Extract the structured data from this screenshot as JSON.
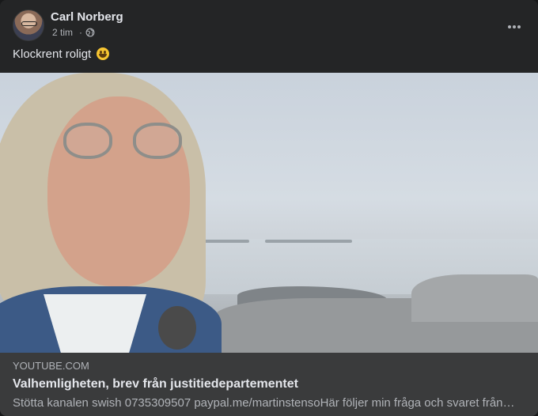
{
  "post": {
    "author": "Carl Norberg",
    "time": "2 tim",
    "separator": "·",
    "privacy_icon": "globe-icon",
    "more_icon": "more-options-icon",
    "text": "Klockrent roligt",
    "emoji": "grinning-face-emoji"
  },
  "link": {
    "domain": "YOUTUBE.COM",
    "title": "Valhemligheten, brev från justitiedepartementet",
    "description": "Stötta kanalen swish 0735309507 paypal.me/martinstensoHär följer min fråga och svaret från…"
  },
  "colors": {
    "background": "#242526",
    "link_box": "#3a3b3c",
    "primary_text": "#e4e6eb",
    "secondary_text": "#b0b3b8"
  }
}
